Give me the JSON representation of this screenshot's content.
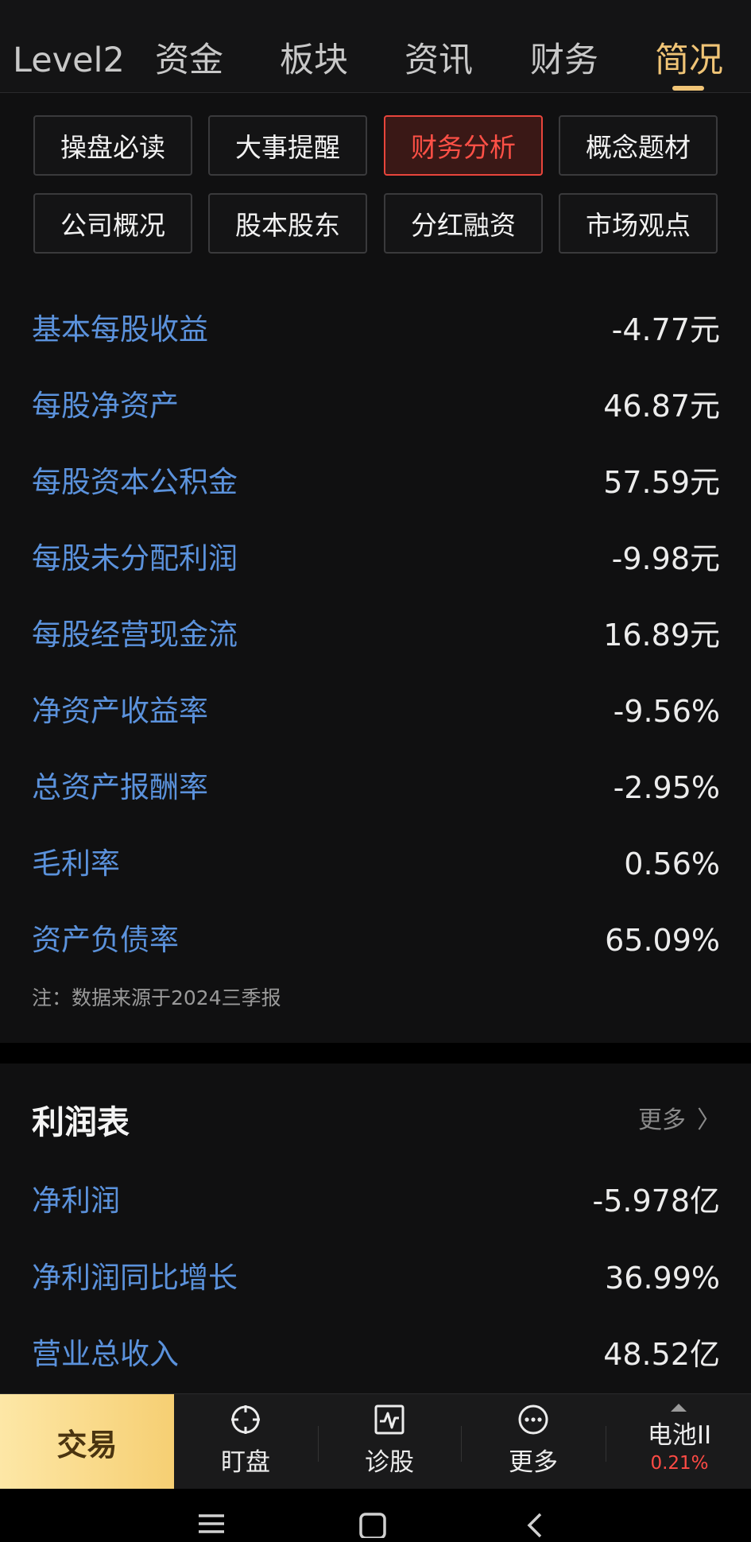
{
  "tabs": [
    {
      "label": "Level2"
    },
    {
      "label": "资金"
    },
    {
      "label": "板块"
    },
    {
      "label": "资讯"
    },
    {
      "label": "财务"
    },
    {
      "label": "简况",
      "active": true
    }
  ],
  "chips": [
    {
      "label": "操盘必读"
    },
    {
      "label": "大事提醒"
    },
    {
      "label": "财务分析",
      "active": true
    },
    {
      "label": "概念题材"
    },
    {
      "label": "公司概况"
    },
    {
      "label": "股本股东"
    },
    {
      "label": "分红融资"
    },
    {
      "label": "市场观点"
    }
  ],
  "metrics": [
    {
      "label": "基本每股收益",
      "value": "-4.77元"
    },
    {
      "label": "每股净资产",
      "value": "46.87元"
    },
    {
      "label": "每股资本公积金",
      "value": "57.59元"
    },
    {
      "label": "每股未分配利润",
      "value": "-9.98元"
    },
    {
      "label": "每股经营现金流",
      "value": "16.89元"
    },
    {
      "label": "净资产收益率",
      "value": "-9.56%"
    },
    {
      "label": "总资产报酬率",
      "value": "-2.95%"
    },
    {
      "label": "毛利率",
      "value": "0.56%"
    },
    {
      "label": "资产负债率",
      "value": "65.09%"
    }
  ],
  "note": "注：数据来源于2024三季报",
  "income": {
    "title": "利润表",
    "more": "更多",
    "rows": [
      {
        "label": "净利润",
        "value": "-5.978亿"
      },
      {
        "label": "净利润同比增长",
        "value": "36.99%"
      },
      {
        "label": "营业总收入",
        "value": "48.52亿"
      }
    ]
  },
  "bottom_nav": {
    "trade": "交易",
    "items": [
      {
        "label": "盯盘",
        "icon": "crosshair-icon"
      },
      {
        "label": "诊股",
        "icon": "pulse-chart-icon"
      },
      {
        "label": "更多",
        "icon": "more-dots-icon"
      }
    ],
    "battery": {
      "name": "电池II",
      "change": "0.21%"
    }
  },
  "colors": {
    "accent_gold": "#f0c476",
    "label_blue": "#5b92dc",
    "active_red": "#ff5046"
  }
}
